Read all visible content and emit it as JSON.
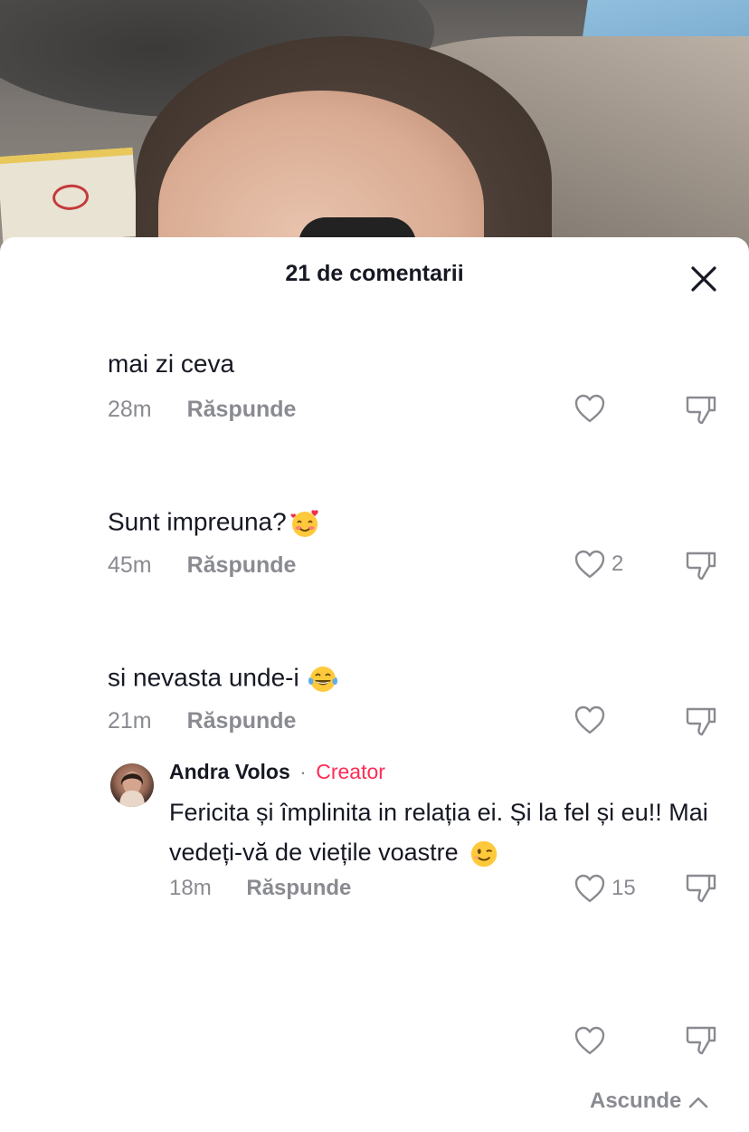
{
  "sheet": {
    "title": "21 de comentarii"
  },
  "comments": [
    {
      "text": "mai zi ceva",
      "time": "28m",
      "reply_label": "Răspunde",
      "likes": ""
    },
    {
      "text": "Sunt impreuna?",
      "time": "45m",
      "reply_label": "Răspunde",
      "likes": "2",
      "emoji": "smiling-face-with-hearts"
    },
    {
      "text": "si nevasta unde-i",
      "time": "21m",
      "reply_label": "Răspunde",
      "likes": "",
      "emoji": "face-with-tears-of-joy"
    }
  ],
  "reply": {
    "author": "Andra Volos",
    "separator": "·",
    "badge": "Creator",
    "text": "Fericita și împlinita in relația ei. Și la fel și eu!! Mai vedeți-vă de viețile voastre",
    "emoji": "winking-face",
    "time": "18m",
    "reply_label": "Răspunde",
    "likes": "15"
  },
  "footer": {
    "hide_label": "Ascunde"
  },
  "colors": {
    "text": "#161823",
    "muted": "#8a8b91",
    "creator": "#fe2c55"
  }
}
